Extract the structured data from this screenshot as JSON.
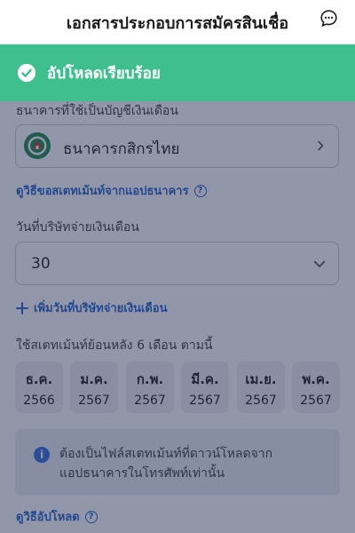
{
  "header": {
    "title": "เอกสารประกอบการสมัครสินเชื่อ",
    "chat_icon": "chat-bubble-icon"
  },
  "toast": {
    "text": "อัปโหลดเรียบร้อย",
    "icon": "check-circle-icon",
    "color": "#3fbf8e"
  },
  "bank": {
    "label": "ธนาคารที่ใช้เป็นบัญชีเงินเดือน",
    "value": "ธนาคารกสิกรไทย",
    "logo": "kbank-logo",
    "how_to_link": "ดูวิธีขอสเตทเม้นท์จากแอปธนาคาร"
  },
  "payday": {
    "label": "วันที่บริษัทจ่ายเงินเดือน",
    "value": "30",
    "add_link": "เพิ่มวันที่บริษัทจ่ายเงินเดือน"
  },
  "statement": {
    "label": "ใช้สเตทเม้นท์ย้อนหลัง 6 เดือน ตามนี้",
    "months": [
      {
        "m": "ธ.ค.",
        "y": "2566"
      },
      {
        "m": "ม.ค.",
        "y": "2567"
      },
      {
        "m": "ก.พ.",
        "y": "2567"
      },
      {
        "m": "มี.ค.",
        "y": "2567"
      },
      {
        "m": "เม.ย.",
        "y": "2567"
      },
      {
        "m": "พ.ค.",
        "y": "2567"
      }
    ],
    "info_line1": "ต้องเป็นไฟล์สเตทเม้นท์ที่ดาวน์โหลดจาก",
    "info_line2": "แอปธนาคารในโทรศัพท์เท่านั้น",
    "upload_link": "ดูวิธีอัปโหลด"
  },
  "colors": {
    "accent": "#1e63c9",
    "success": "#3fbf8e"
  }
}
